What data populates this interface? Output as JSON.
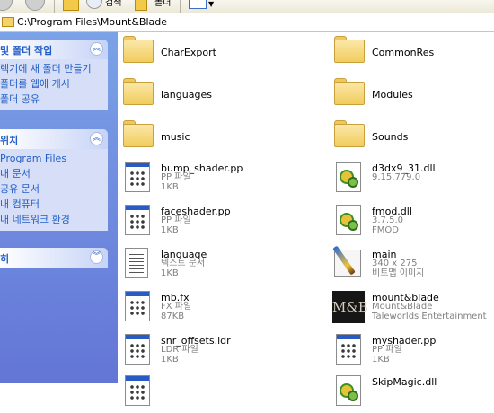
{
  "toolbar": {
    "search_label": "검색",
    "folders_label": "폴더"
  },
  "address": {
    "path": "C:\\Program Files\\Mount&Blade"
  },
  "taskpane": {
    "file_folder_tasks": {
      "title": "및 폴더 작업",
      "links": [
        "렉기에 새 폴더 만들기",
        "폴더를 웹에 게시",
        "폴더 공유"
      ]
    },
    "other_places": {
      "title": "위치",
      "links": [
        "Program Files",
        "내 문서",
        "공유 문서",
        "내 컴퓨터",
        "내 네트워크 환경"
      ]
    },
    "details": {
      "title": "히"
    }
  },
  "files": [
    {
      "name": "CharExport",
      "type": "folder"
    },
    {
      "name": "CommonRes",
      "type": "folder"
    },
    {
      "name": "languages",
      "type": "folder"
    },
    {
      "name": "Modules",
      "type": "folder"
    },
    {
      "name": "music",
      "type": "folder"
    },
    {
      "name": "Sounds",
      "type": "folder"
    },
    {
      "name": "bump_shader.pp",
      "type": "doc",
      "line2": "PP 파일",
      "line3": "1KB"
    },
    {
      "name": "d3dx9_31.dll",
      "type": "dll",
      "line2": "9.15.779.0",
      "line3": ""
    },
    {
      "name": "faceshader.pp",
      "type": "doc",
      "line2": "PP 파일",
      "line3": "1KB"
    },
    {
      "name": "fmod.dll",
      "type": "dll",
      "line2": "3.7.5.0",
      "line3": "FMOD"
    },
    {
      "name": "language",
      "type": "txt",
      "line2": "텍스트 문서",
      "line3": "1KB"
    },
    {
      "name": "main",
      "type": "bmp",
      "line2": "340 x 275",
      "line3": "비트맵 이미지"
    },
    {
      "name": "mb.fx",
      "type": "doc",
      "line2": "FX 파일",
      "line3": "87KB"
    },
    {
      "name": "mount&blade",
      "type": "mb",
      "line2": "Mount&Blade",
      "line3": "Taleworlds Entertainment"
    },
    {
      "name": "snr_offsets.ldr",
      "type": "doc",
      "line2": "LDR 파일",
      "line3": "1KB"
    },
    {
      "name": "myshader.pp",
      "type": "doc",
      "line2": "PP 파일",
      "line3": "1KB"
    },
    {
      "name": "",
      "type": "doc",
      "line2": "",
      "line3": ""
    },
    {
      "name": "SkipMagic.dll",
      "type": "dll",
      "line2": "",
      "line3": ""
    }
  ]
}
